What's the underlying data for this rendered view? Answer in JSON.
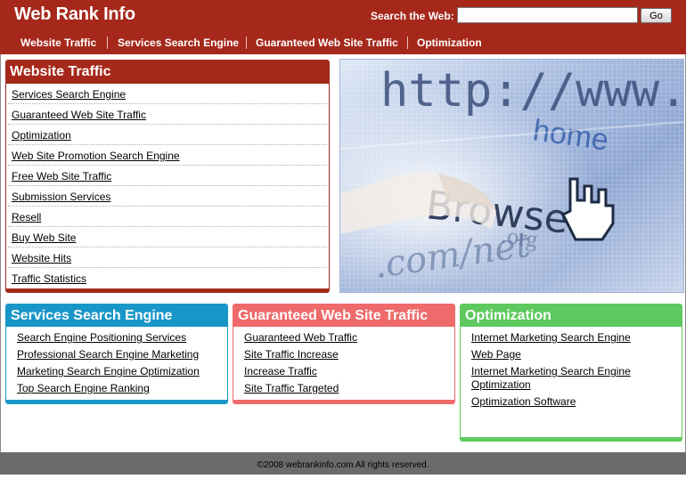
{
  "site": {
    "title": "Web Rank Info"
  },
  "search": {
    "label": "Search the Web:",
    "value": "",
    "placeholder": "",
    "button_label": "Go"
  },
  "nav": [
    "Website Traffic",
    "Services Search Engine",
    "Guaranteed Web Site Traffic",
    "Optimization"
  ],
  "sidebar": {
    "heading": "Website Traffic",
    "links": [
      "Services Search Engine",
      "Guaranteed Web Site Traffic",
      "Optimization",
      "Web Site Promotion Search Engine",
      "Free Web Site Traffic",
      "Submission Services",
      "Resell",
      "Buy Web Site",
      "Website Hits",
      "Traffic Statistics"
    ]
  },
  "hero": {
    "url_text": "http://www.",
    "home_text": "home",
    "browse_text": "Browse",
    "org_text": ".org",
    "comnet_text": ".com/net"
  },
  "boxes": [
    {
      "heading": "Services Search Engine",
      "color": "#1996c8",
      "links": [
        "Search Engine Positioning Services",
        "Professional Search Engine Marketing",
        "Marketing Search Engine Optimization",
        "Top Search Engine Ranking"
      ]
    },
    {
      "heading": "Guaranteed Web Site Traffic",
      "color": "#ef6a6a",
      "links": [
        "Guaranteed Web Traffic",
        "Site Traffic Increase",
        "Increase Traffic",
        "Site Traffic Targeted"
      ]
    },
    {
      "heading": "Optimization",
      "color": "#5ec95e",
      "links": [
        "Internet Marketing Search Engine",
        "Web Page",
        "Internet Marketing Search Engine Optimization",
        "Optimization Software"
      ]
    }
  ],
  "footer": {
    "text": "©2008 webrankinfo.com All rights reserved."
  },
  "colors": {
    "brand": "#a5281b",
    "footer": "#6b6b6b"
  }
}
